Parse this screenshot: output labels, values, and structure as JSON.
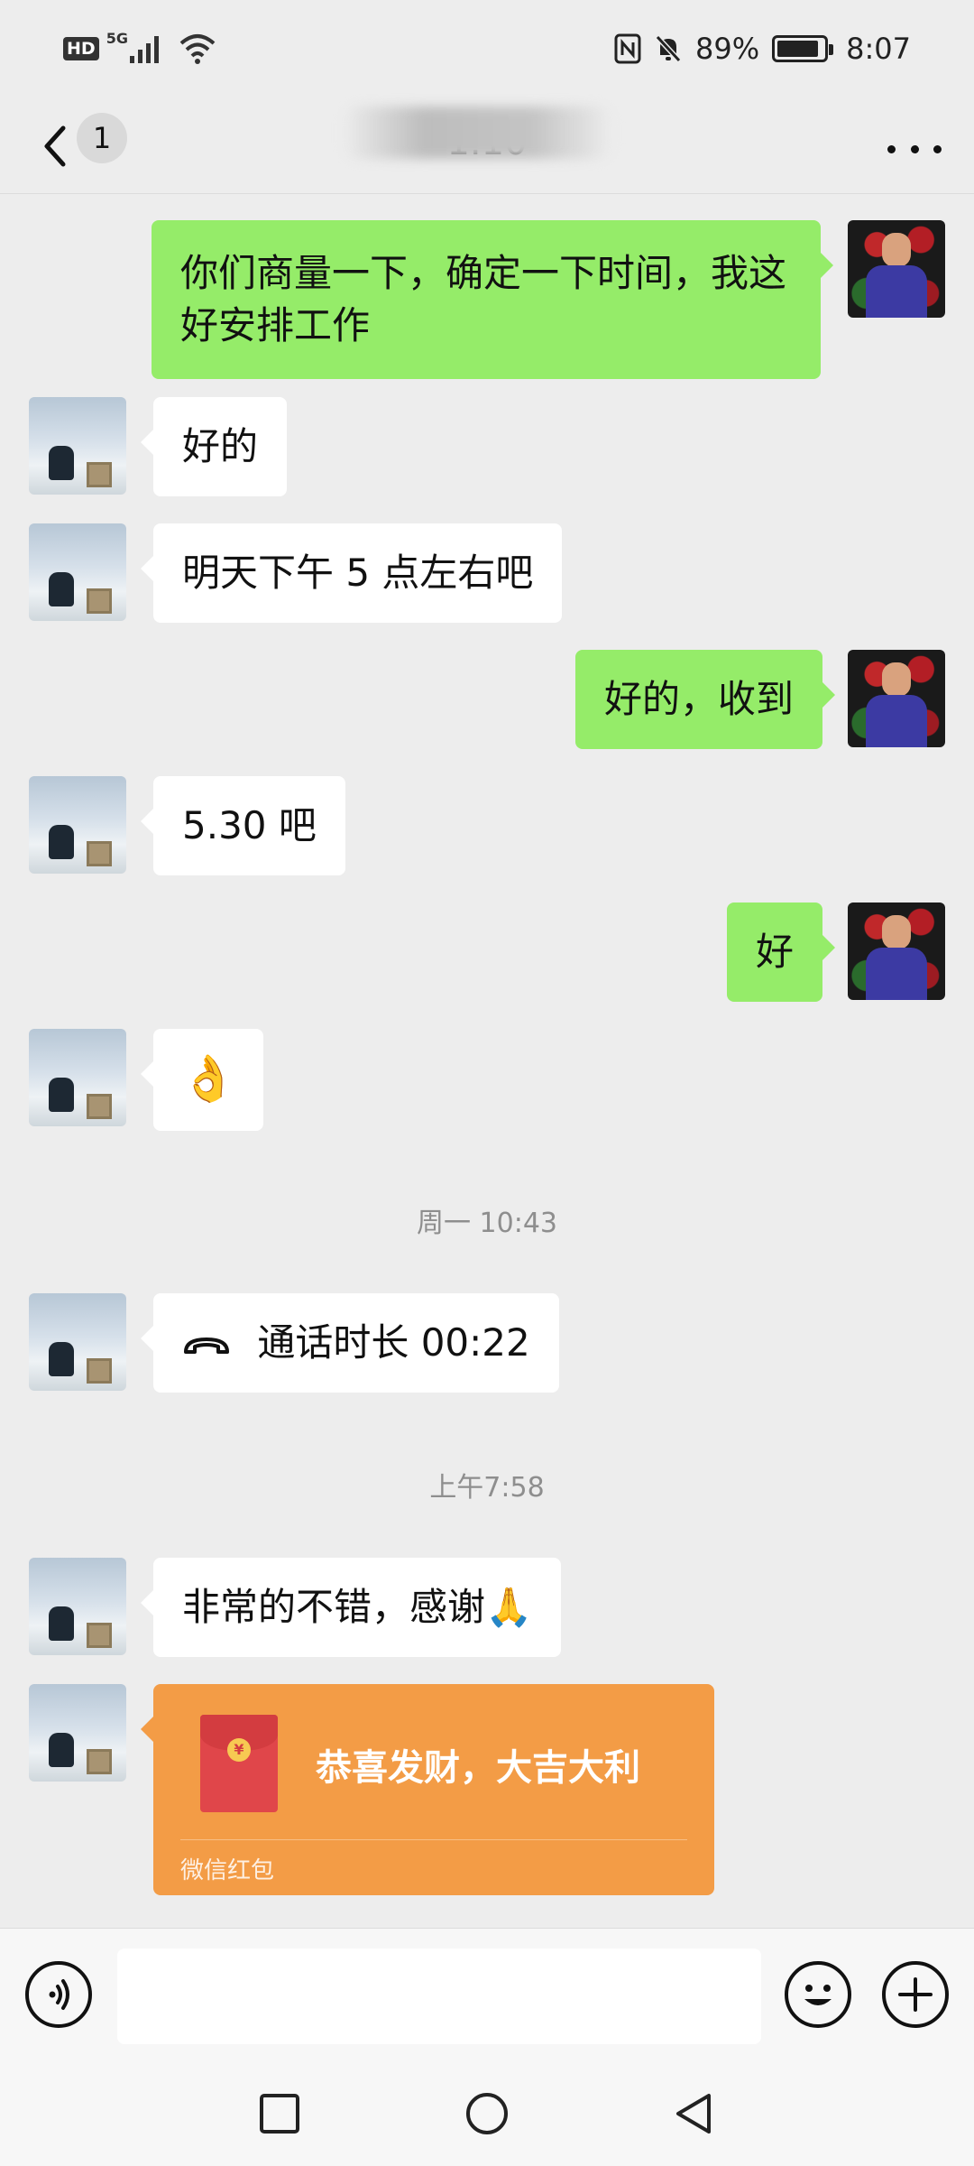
{
  "status_bar": {
    "hd": "HD",
    "network": "5G",
    "battery_percent": "89%",
    "battery_level": 0.89,
    "time": "8:07"
  },
  "nav": {
    "unread_count": "1",
    "title": "1.10"
  },
  "messages": [
    {
      "side": "right",
      "text": "你们商量一下，确定一下时间，我这好安排工作"
    },
    {
      "side": "left",
      "text": "好的"
    },
    {
      "side": "left",
      "text": "明天下午 5 点左右吧"
    },
    {
      "side": "right",
      "text": "好的，收到"
    },
    {
      "side": "left",
      "text": "5.30 吧"
    },
    {
      "side": "right",
      "text": "好"
    },
    {
      "side": "left",
      "text": "👌"
    },
    {
      "side": "left",
      "text": "通话时长 00:22"
    },
    {
      "side": "left",
      "text": "非常的不错，感谢🙏"
    }
  ],
  "timestamps": [
    "周一 10:43",
    "上午7:58"
  ],
  "red_packet": {
    "title": "恭喜发财，大吉大利",
    "footer": "微信红包"
  },
  "input": {
    "placeholder": ""
  },
  "colors": {
    "background": "#ededed",
    "bubble_right": "#95ec69",
    "bubble_left": "#ffffff",
    "red_packet": "#f39c46"
  },
  "icons": [
    "back-icon",
    "more-icon",
    "voice-icon",
    "emoji-icon",
    "plus-icon",
    "phone-icon",
    "recent-apps-icon",
    "home-icon",
    "back-nav-icon"
  ]
}
